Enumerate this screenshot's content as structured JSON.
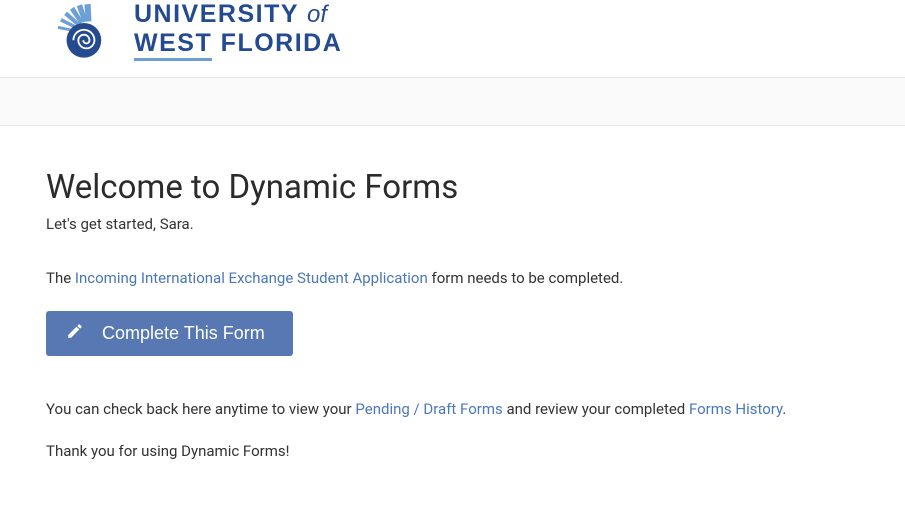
{
  "logo": {
    "line1a": "UNIVERSITY",
    "line1b": "of",
    "line2a": "WEST",
    "line2b": "FLORIDA"
  },
  "main": {
    "title": "Welcome to Dynamic Forms",
    "greeting": "Let's get started, Sara.",
    "form_prefix": "The ",
    "form_link": "Incoming International Exchange Student Application",
    "form_suffix": " form needs to be completed.",
    "button_label": "Complete This Form",
    "info_prefix": "You can check back here anytime to view your ",
    "pending_link": "Pending / Draft Forms",
    "info_mid": " and review your completed ",
    "history_link": "Forms History",
    "info_suffix": ".",
    "thanks": "Thank you for using Dynamic Forms!"
  }
}
